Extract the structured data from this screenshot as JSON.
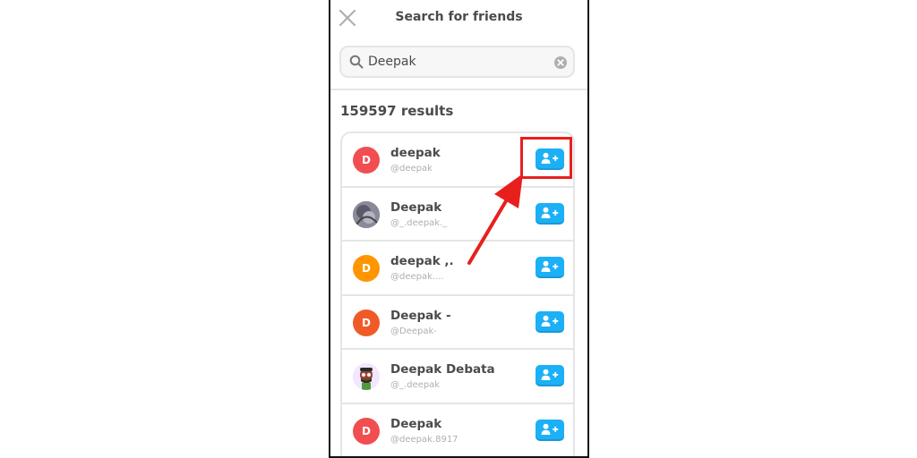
{
  "header": {
    "title": "Search for friends"
  },
  "search": {
    "value": "Deepak"
  },
  "results": {
    "count_label": "159597 results"
  },
  "users": [
    {
      "name": "deepak",
      "handle": "@deepak",
      "avatar_letter": "D",
      "avatar_color": "#f04e50"
    },
    {
      "name": "Deepak",
      "handle": "@_.deepak._",
      "avatar_letter": "",
      "avatar_color": "#6b6b7a"
    },
    {
      "name": "deepak ,.",
      "handle": "@deepak....",
      "avatar_letter": "D",
      "avatar_color": "#ff9600"
    },
    {
      "name": "Deepak -",
      "handle": "@Deepak-",
      "avatar_letter": "D",
      "avatar_color": "#f05a28"
    },
    {
      "name": "Deepak Debata",
      "handle": "@_.deepak",
      "avatar_letter": "",
      "avatar_color": "#f3e6ff"
    },
    {
      "name": "Deepak",
      "handle": "@deepak.8917",
      "avatar_letter": "D",
      "avatar_color": "#f04e50"
    }
  ],
  "colors": {
    "accent": "#1cb0f6",
    "annotation": "#e8201d"
  }
}
